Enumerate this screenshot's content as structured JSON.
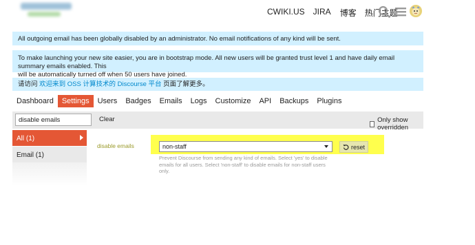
{
  "header": {
    "links": [
      "CWIKI.US",
      "JIRA",
      "博客",
      "热门主题"
    ],
    "icons": [
      "search-icon",
      "hamburger-menu-icon",
      "avatar"
    ]
  },
  "alerts": {
    "disabled_email": "All outgoing email has been globally disabled by an administrator. No email notifications of any kind will be sent.",
    "bootstrap_line1": "To make launching your new site easier, you are in bootstrap mode. All new users will be granted trust level 1 and have daily email summary emails enabled. This",
    "bootstrap_line2": "will be automatically turned off when 50 users have joined.",
    "visit_prefix": "请访问 ",
    "visit_link": "欢迎来到 OSS 计算技术的 Discourse 平台",
    "visit_suffix": " 页面了解更多。"
  },
  "tabs": [
    "Dashboard",
    "Settings",
    "Users",
    "Badges",
    "Emails",
    "Logs",
    "Customize",
    "API",
    "Backups",
    "Plugins"
  ],
  "active_tab": "Settings",
  "filter": {
    "value": "disable emails",
    "clear_label": "Clear",
    "only_overridden_label": "Only show overridden",
    "only_overridden_checked": false
  },
  "categories": [
    {
      "label": "All (1)",
      "active": true
    },
    {
      "label": "Email (1)",
      "active": false
    }
  ],
  "setting": {
    "name": "disable emails",
    "value": "non-staff",
    "reset_label": "reset",
    "description_line1": "Prevent Discourse from sending any kind of emails. Select 'yes' to disable",
    "description_line2": "emails for all users. Select 'non-staff' to disable emails for non-staff users only."
  },
  "colors": {
    "accent": "#e45735",
    "alert_bg": "#d1f0ff",
    "highlight": "#ffff4d",
    "link": "#0088cc"
  }
}
